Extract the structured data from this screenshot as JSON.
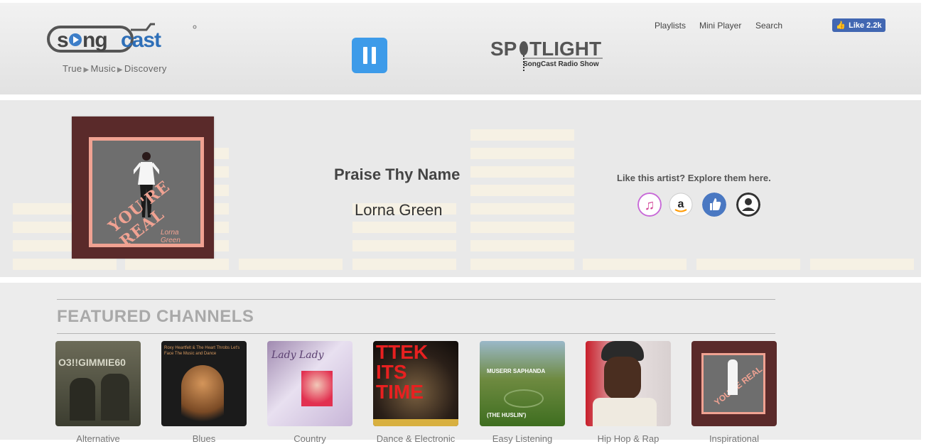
{
  "header": {
    "logo_text": "songcast",
    "tagline": [
      "True",
      "Music",
      "Discovery"
    ],
    "spotlight_word": "SPOTLIGHT",
    "spotlight_sub": "SongCast Radio Show",
    "nav": [
      "Playlists",
      "Mini Player",
      "Search"
    ],
    "like_label": "Like 2.2k"
  },
  "player": {
    "song_title": "Praise Thy Name",
    "artist": "Lorna Green",
    "album_text": "YOU'RE REAL",
    "album_artist": "Lorna Green",
    "explore_label": "Like this artist? Explore them here.",
    "links": [
      "itunes-icon",
      "amazon-icon",
      "thumbs-up-icon",
      "profile-icon"
    ]
  },
  "featured": {
    "title": "FEATURED CHANNELS",
    "channels": [
      {
        "label": "Alternative",
        "art_text": "O3!!GIMMIE60"
      },
      {
        "label": "Blues",
        "art_text": "Roxy Heartfelt & The Heart Throbs Let's Face The Music and Dance"
      },
      {
        "label": "Country",
        "art_text": "Lady Lady"
      },
      {
        "label": "Dance & Electronic",
        "art_text": "TTEK ITS TIME"
      },
      {
        "label": "Easy Listening",
        "art_text": "MUSERR SAPHANDA (THE HUSLIN')"
      },
      {
        "label": "Hip Hop & Rap",
        "art_text": ""
      },
      {
        "label": "Inspirational",
        "art_text": "YOU'RE REAL"
      }
    ]
  },
  "colors": {
    "play_button": "#3d9be9",
    "facebook": "#4267b2",
    "album_bg": "#5a2a2a",
    "album_accent": "#f0a292"
  }
}
